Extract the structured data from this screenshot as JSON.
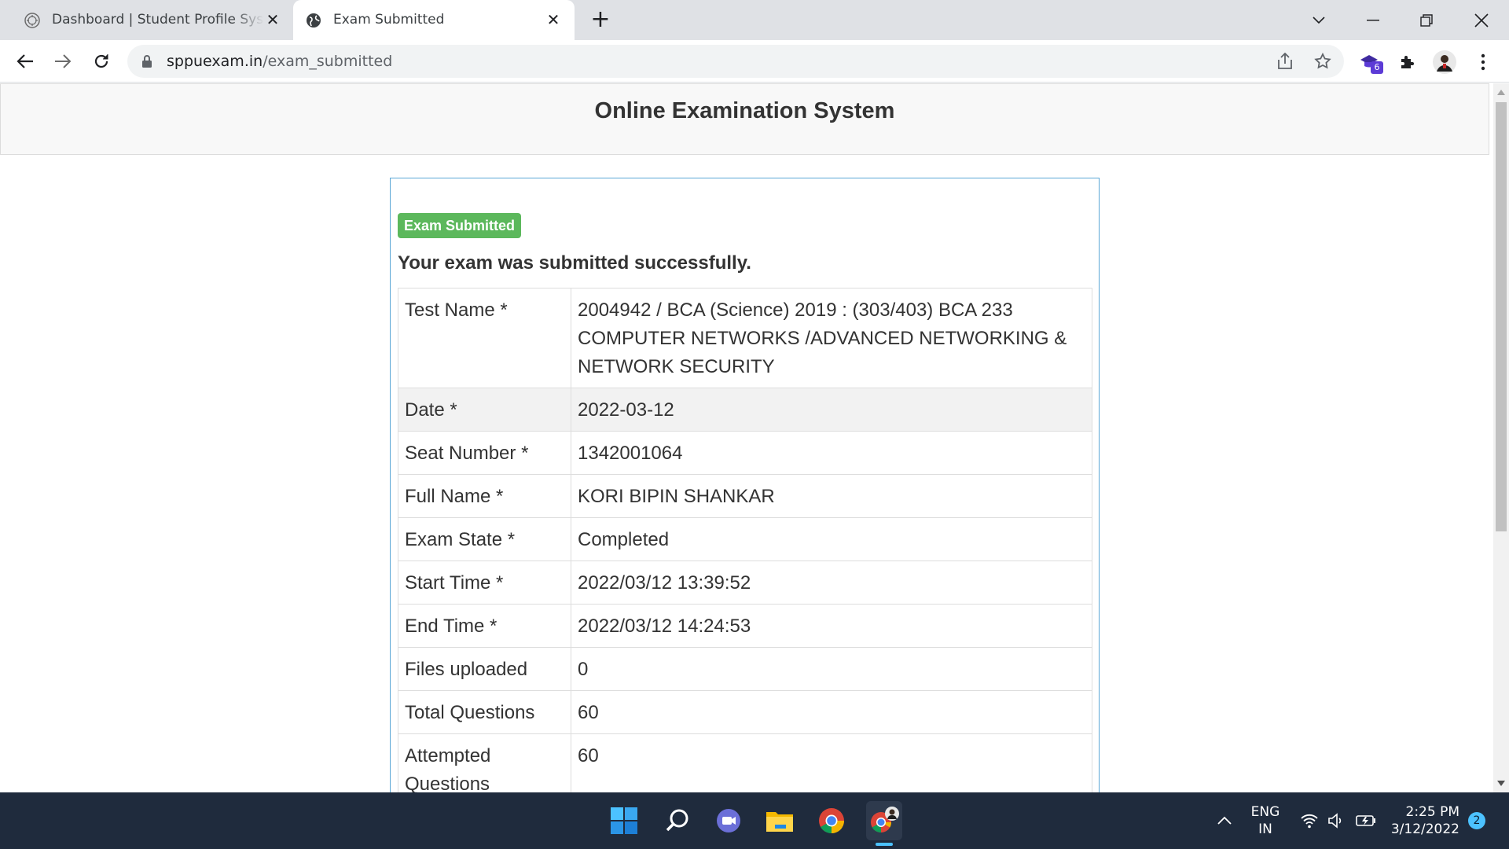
{
  "browser": {
    "tabs": [
      {
        "title": "Dashboard | Student Profile System",
        "active": false
      },
      {
        "title": "Exam Submitted",
        "active": true
      }
    ],
    "new_tab_label": "+",
    "url_domain": "sppuexam.in",
    "url_path": "/exam_submitted",
    "extension_badge": "6"
  },
  "page": {
    "site_title": "Online Examination System",
    "status_label": "Exam Submitted",
    "success_message": "Your exam was submitted successfully.",
    "details": [
      {
        "key": "Test Name *",
        "value": "2004942 / BCA (Science) 2019 : (303/403) BCA 233 COMPUTER NETWORKS /ADVANCED NETWORKING & NETWORK SECURITY"
      },
      {
        "key": "Date *",
        "value": "2022-03-12"
      },
      {
        "key": "Seat Number *",
        "value": "1342001064"
      },
      {
        "key": "Full Name *",
        "value": "KORI BIPIN SHANKAR"
      },
      {
        "key": "Exam State *",
        "value": "Completed"
      },
      {
        "key": "Start Time *",
        "value": "2022/03/12 13:39:52"
      },
      {
        "key": "End Time *",
        "value": "2022/03/12 14:24:53"
      },
      {
        "key": "Files uploaded",
        "value": "0"
      },
      {
        "key": "Total Questions",
        "value": "60"
      },
      {
        "key": "Attempted Questions",
        "value": "60"
      }
    ],
    "status_color": "#5cb85c"
  },
  "taskbar": {
    "lang_line1": "ENG",
    "lang_line2": "IN",
    "time": "2:25 PM",
    "date": "3/12/2022",
    "notification_count": "2",
    "apps": [
      "windows-start",
      "search",
      "teams-chat",
      "file-explorer",
      "chrome",
      "chrome-profile"
    ]
  }
}
